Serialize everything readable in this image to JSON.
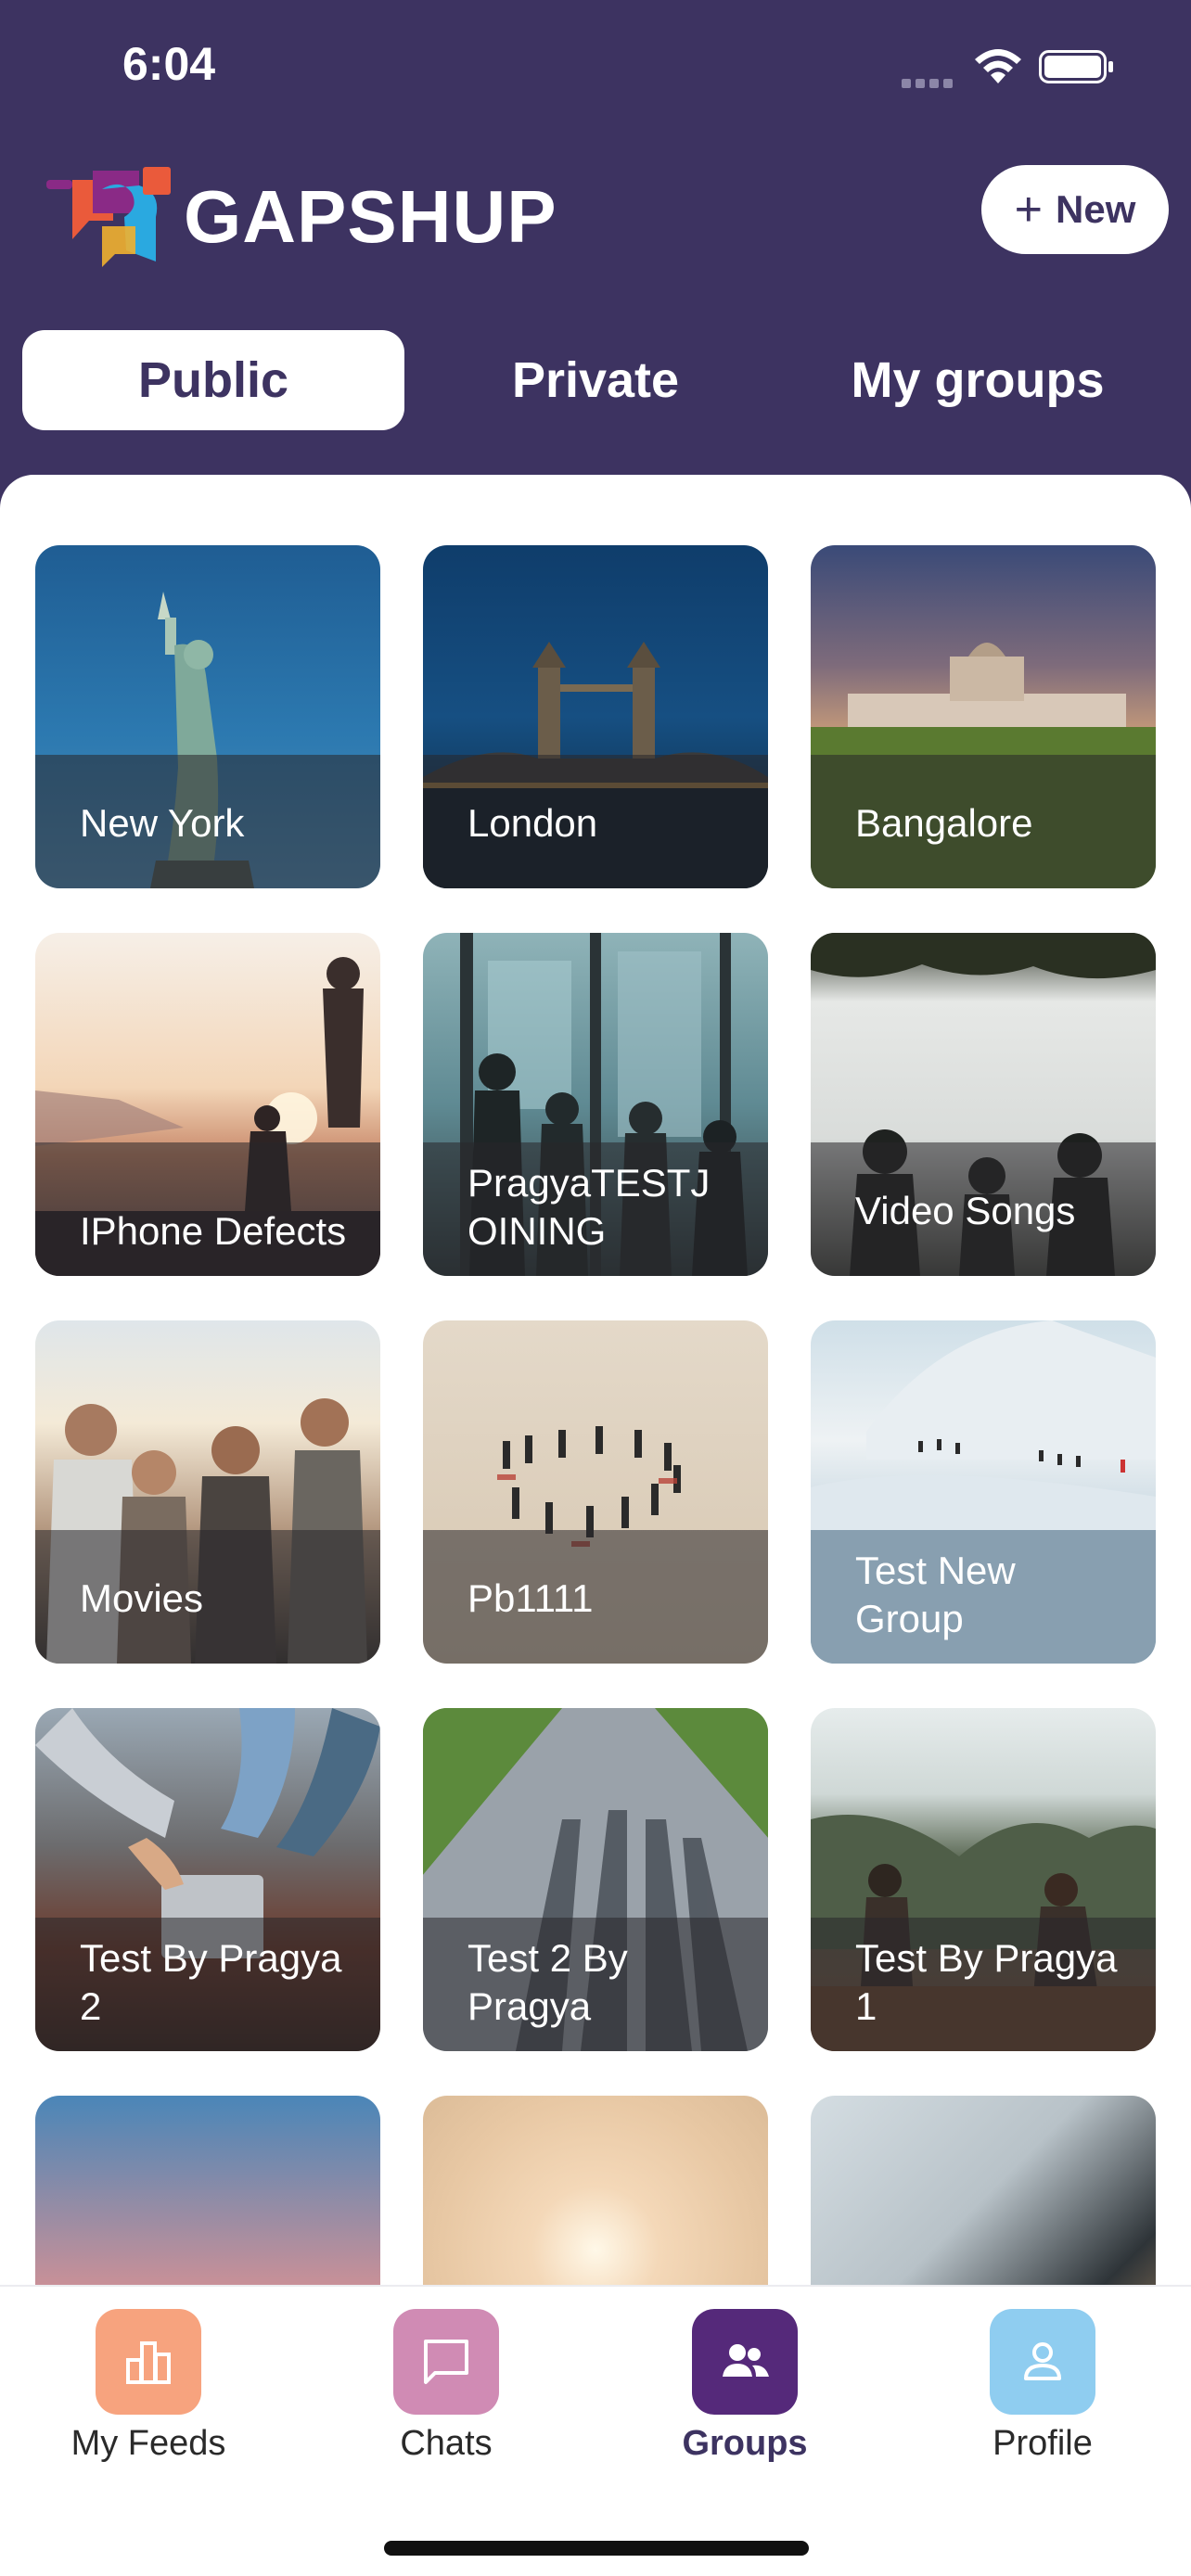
{
  "status_bar": {
    "time": "6:04"
  },
  "header": {
    "brand": "GAPSHUP",
    "new_button_label": "New"
  },
  "tabs": [
    {
      "label": "Public",
      "active": true
    },
    {
      "label": "Private",
      "active": false
    },
    {
      "label": "My groups",
      "active": false
    }
  ],
  "groups": [
    {
      "name": "New York",
      "image": "statue-of-liberty"
    },
    {
      "name": "London",
      "image": "tower-bridge-night"
    },
    {
      "name": "Bangalore",
      "image": "palace-sunset"
    },
    {
      "name": "IPhone Defects",
      "image": "silhouettes-sunset"
    },
    {
      "name": "PragyaTESTJOINING",
      "image": "people-at-window"
    },
    {
      "name": "Video Songs",
      "image": "people-under-trees"
    },
    {
      "name": "Movies",
      "image": "friends-laughing"
    },
    {
      "name": "Pb1111",
      "image": "people-on-sand"
    },
    {
      "name": "Test New Group",
      "image": "snowy-mountain"
    },
    {
      "name": "Test By Pragya 2",
      "image": "hands-on-laptop"
    },
    {
      "name": "Test 2 By Pragya",
      "image": "shadows-on-road"
    },
    {
      "name": "Test By Pragya 1",
      "image": "mountain-picnic"
    },
    {
      "name": "",
      "image": "sunset-sky"
    },
    {
      "name": "",
      "image": "hazy-sun"
    },
    {
      "name": "",
      "image": "people-chatting"
    }
  ],
  "bottom_nav": [
    {
      "label": "My Feeds",
      "icon": "bar-chart-icon",
      "color": "#f7a37e",
      "active": false
    },
    {
      "label": "Chats",
      "icon": "chat-bubble-icon",
      "color": "#d08bb4",
      "active": false
    },
    {
      "label": "Groups",
      "icon": "people-icon",
      "color": "#55297a",
      "active": true
    },
    {
      "label": "Profile",
      "icon": "person-icon",
      "color": "#8fcdf0",
      "active": false
    }
  ],
  "colors": {
    "brand": "#3d3361",
    "background": "#ffffff"
  }
}
